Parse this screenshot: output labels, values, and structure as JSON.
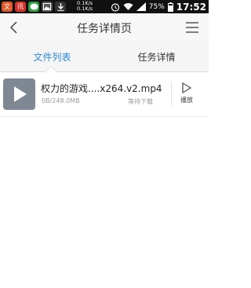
{
  "statusbar": {
    "app_icon_labels": [
      "文",
      "讯"
    ],
    "speed_down": "0.1K/s",
    "speed_up": "0.1K/s",
    "battery": "75%",
    "time": "17:52"
  },
  "header": {
    "title": "任务详情页"
  },
  "tabs": [
    {
      "label": "文件列表",
      "active": true
    },
    {
      "label": "任务详情",
      "active": false
    }
  ],
  "files": [
    {
      "name": "权力的游戏....x264.v2.mp4",
      "size": "0B/248.0MB",
      "status": "等待下载",
      "action": "播放"
    }
  ],
  "colors": {
    "accent": "#2e8ad8",
    "statusbar": "#111111",
    "thumbnail": "#7f8792"
  }
}
